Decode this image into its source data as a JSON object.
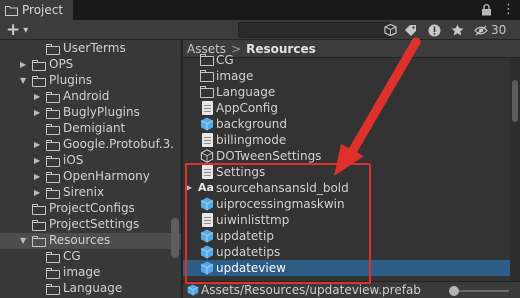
{
  "window": {
    "tab_title": "Project",
    "badge_count": "30",
    "icons": [
      "lock-icon",
      "more-icon"
    ]
  },
  "toolbar": {
    "add_label": "+",
    "add_dropdown": "▾",
    "search_placeholder": "",
    "filter_icons": [
      "scene-icon",
      "tag-icon",
      "warning-icon",
      "star-icon",
      "eye-icon"
    ]
  },
  "tree": {
    "items": [
      {
        "label": "UserTerms",
        "depth": 2,
        "expandable": false,
        "expanded": false
      },
      {
        "label": "OPS",
        "depth": 1,
        "expandable": true,
        "expanded": false
      },
      {
        "label": "Plugins",
        "depth": 1,
        "expandable": true,
        "expanded": true
      },
      {
        "label": "Android",
        "depth": 2,
        "expandable": true,
        "expanded": false
      },
      {
        "label": "BuglyPlugins",
        "depth": 2,
        "expandable": true,
        "expanded": false
      },
      {
        "label": "Demigiant",
        "depth": 2,
        "expandable": false,
        "expanded": false
      },
      {
        "label": "Google.Protobuf.3.",
        "depth": 2,
        "expandable": true,
        "expanded": false
      },
      {
        "label": "iOS",
        "depth": 2,
        "expandable": true,
        "expanded": false
      },
      {
        "label": "OpenHarmony",
        "depth": 2,
        "expandable": true,
        "expanded": false
      },
      {
        "label": "Sirenix",
        "depth": 2,
        "expandable": true,
        "expanded": false
      },
      {
        "label": "ProjectConfigs",
        "depth": 1,
        "expandable": false,
        "expanded": false
      },
      {
        "label": "ProjectSettings",
        "depth": 1,
        "expandable": false,
        "expanded": false
      },
      {
        "label": "Resources",
        "depth": 1,
        "expandable": true,
        "expanded": true,
        "selected": true
      },
      {
        "label": "CG",
        "depth": 2,
        "expandable": false,
        "expanded": false
      },
      {
        "label": "image",
        "depth": 2,
        "expandable": false,
        "expanded": false
      },
      {
        "label": "Language",
        "depth": 2,
        "expandable": false,
        "expanded": false
      }
    ]
  },
  "breadcrumb": {
    "parent": "Assets",
    "separator": ">",
    "current": "Resources"
  },
  "assets": {
    "items": [
      {
        "label": "CG",
        "icon": "folder-icon"
      },
      {
        "label": "image",
        "icon": "folder-icon"
      },
      {
        "label": "Language",
        "icon": "folder-icon"
      },
      {
        "label": "AppConfig",
        "icon": "text-file-icon"
      },
      {
        "label": "background",
        "icon": "prefab-icon"
      },
      {
        "label": "billingmode",
        "icon": "text-file-icon"
      },
      {
        "label": "DOTweenSettings",
        "icon": "scriptable-object-icon"
      },
      {
        "label": "Settings",
        "icon": "text-file-icon"
      },
      {
        "label": "sourcehansansld_bold",
        "icon": "font-icon",
        "expandable": true
      },
      {
        "label": "uiprocessingmaskwin",
        "icon": "prefab-icon"
      },
      {
        "label": "uiwinlisttmp",
        "icon": "text-file-icon"
      },
      {
        "label": "updatetip",
        "icon": "prefab-icon"
      },
      {
        "label": "updatetips",
        "icon": "prefab-icon"
      },
      {
        "label": "updateview",
        "icon": "prefab-icon",
        "selected": true
      }
    ]
  },
  "status": {
    "path": "Assets/Resources/updateview.prefab"
  },
  "colors": {
    "selection": "#2c5d87",
    "annotation": "#e0302b",
    "prefab": "#58a9e8"
  }
}
